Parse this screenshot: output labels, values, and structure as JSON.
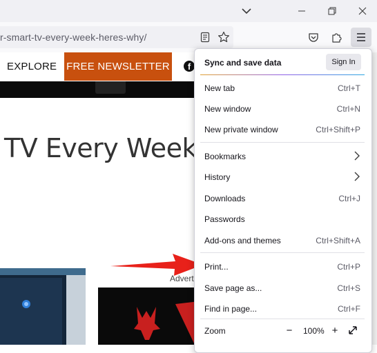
{
  "window": {
    "controls": [
      "chevron-down",
      "minimize",
      "restore",
      "close"
    ]
  },
  "navbar": {
    "url": "r-smart-tv-every-week-heres-why/"
  },
  "site": {
    "explore": "EXPLORE",
    "newsletter": "FREE NEWSLETTER",
    "headline": "TV Every Week:",
    "ad_label": "Advert"
  },
  "menu": {
    "sync_label": "Sync and save data",
    "sign_in": "Sign In",
    "items": [
      {
        "label": "New tab",
        "shortcut": "Ctrl+T"
      },
      {
        "label": "New window",
        "shortcut": "Ctrl+N"
      },
      {
        "label": "New private window",
        "shortcut": "Ctrl+Shift+P"
      },
      {
        "label": "Bookmarks",
        "shortcut": ""
      },
      {
        "label": "History",
        "shortcut": ""
      },
      {
        "label": "Downloads",
        "shortcut": "Ctrl+J"
      },
      {
        "label": "Passwords",
        "shortcut": ""
      },
      {
        "label": "Add-ons and themes",
        "shortcut": "Ctrl+Shift+A"
      },
      {
        "label": "Print...",
        "shortcut": "Ctrl+P"
      },
      {
        "label": "Save page as...",
        "shortcut": "Ctrl+S"
      },
      {
        "label": "Find in page...",
        "shortcut": "Ctrl+F"
      }
    ],
    "zoom_label": "Zoom",
    "zoom_value": "100%",
    "zoom_minus": "−",
    "zoom_plus": "+"
  },
  "colors": {
    "newsletter_bg": "#c8500e",
    "arrow": "#e8211a",
    "sync_underline": "#8f5ee6"
  }
}
